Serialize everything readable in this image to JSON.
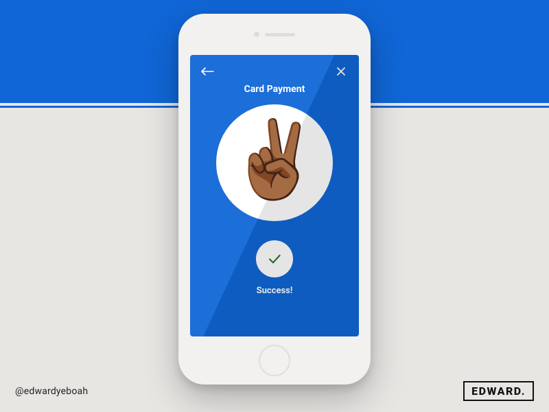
{
  "screen": {
    "title": "Card Payment",
    "success_label": "Success!",
    "illustration": "✌🏾",
    "icons": {
      "back": "back-arrow-icon",
      "close": "close-icon",
      "check": "checkmark-icon"
    }
  },
  "footer": {
    "handle": "@edwardyeboah",
    "logo": "EDWARD."
  },
  "colors": {
    "primary": "#1066d6",
    "background": "#e8e6e3",
    "check": "#2f7a2f"
  }
}
